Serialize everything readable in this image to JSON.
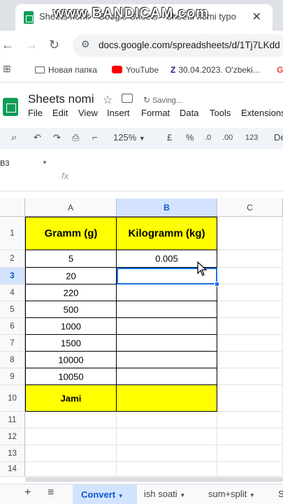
{
  "browser": {
    "tab_title": "Sheets nomi - Google Sheets - Sheets nomi typo",
    "watermark": "www.BANDICAM.com",
    "close_glyph": "✕",
    "url": "docs.google.com/spreadsheets/d/1Tj7LKdd",
    "bookmarks": [
      {
        "label": "Новая папка",
        "icon": "folder-icon"
      },
      {
        "label": "YouTube",
        "icon": "youtube-icon"
      },
      {
        "label": "30.04.2023. O'zbeki...",
        "icon": "bookmark-icon"
      }
    ]
  },
  "sheet": {
    "title": "Sheets nomi",
    "saving": "Saving...",
    "menu": [
      "File",
      "Edit",
      "View",
      "Insert",
      "Format",
      "Data",
      "Tools",
      "Extensions"
    ],
    "zoom": "125%",
    "currency": "£",
    "percent": "%",
    "dec_decrease": ".0",
    "dec_increase": ".00",
    "number_format": "123",
    "font": "De",
    "name_box": "B3",
    "fx": "fx"
  },
  "grid": {
    "columns": [
      "A",
      "B",
      "C"
    ],
    "rows": [
      "1",
      "2",
      "3",
      "4",
      "5",
      "6",
      "7",
      "8",
      "9",
      "10",
      "11",
      "12",
      "13",
      "14"
    ],
    "header_a": "Gramm (g)",
    "header_b": "Kilogramm (kg)",
    "grams": [
      "5",
      "20",
      "220",
      "500",
      "1000",
      "1500",
      "10000",
      "10050"
    ],
    "kilograms": [
      "0.005",
      "",
      "",
      "",
      "",
      "",
      "",
      ""
    ],
    "total_label": "Jami",
    "highlight_color": "#ffff00",
    "selection_color": "#1a73e8"
  },
  "sheet_tabs": {
    "add": "+",
    "list": "≡",
    "tabs": [
      "Convert",
      "ish soati",
      "sum+split",
      "S"
    ],
    "active": "Convert"
  }
}
